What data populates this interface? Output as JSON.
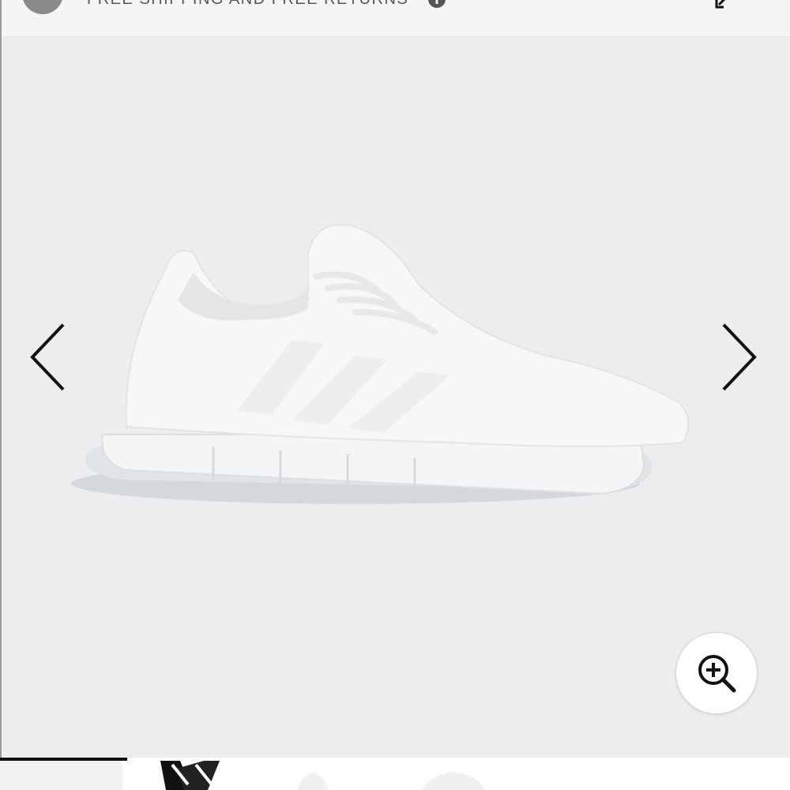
{
  "banner": {
    "promo_text": "FREE SHIPPING AND FREE RETURNS"
  },
  "gallery": {
    "image_alt": "White knit running sneaker with three stripes",
    "prev_icon": "chevron-left-icon",
    "next_icon": "chevron-right-icon",
    "zoom_icon": "zoom-in-icon"
  },
  "thumbnails": {
    "count_visible": 4,
    "active_index": 0
  },
  "colors": {
    "background": "#ebedee",
    "shoe": "#f7f7f7",
    "icon": "#111111"
  }
}
